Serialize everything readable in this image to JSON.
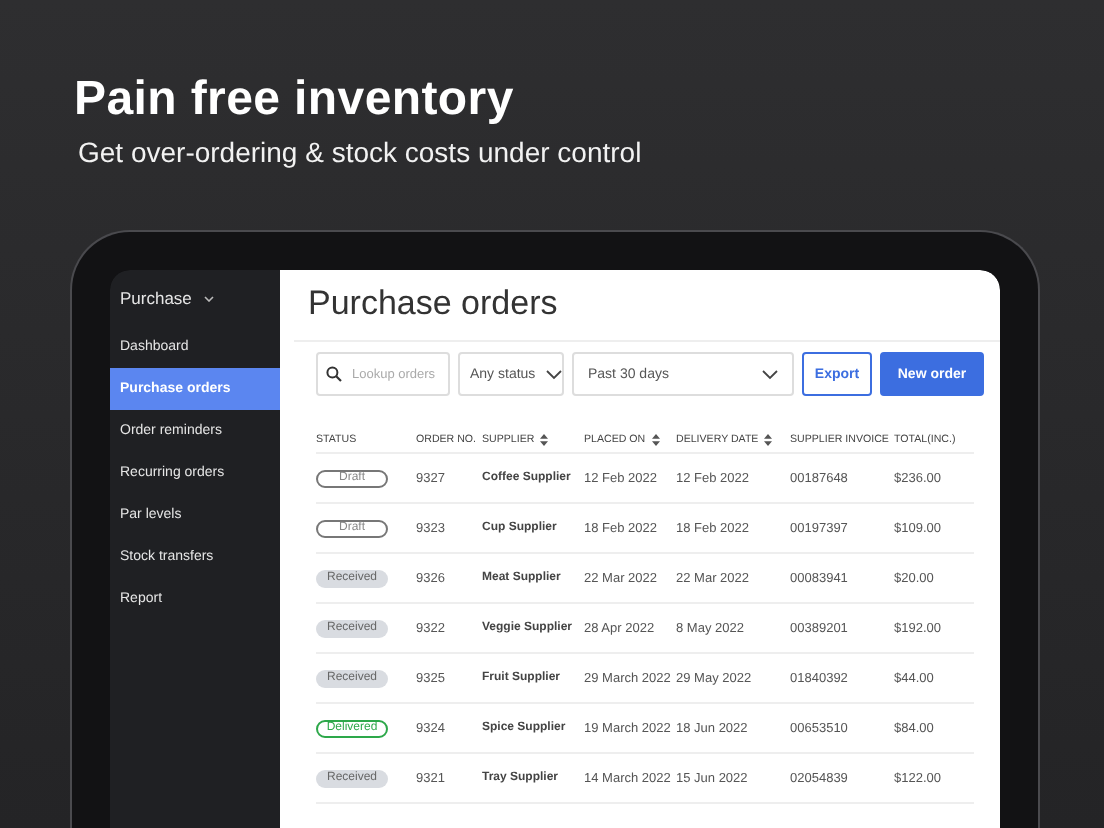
{
  "headline": {
    "title": "Pain free inventory",
    "subtitle": "Get over-ordering & stock costs under control"
  },
  "sidebar": {
    "section": "Purchase",
    "items": [
      {
        "label": "Dashboard",
        "selected": false
      },
      {
        "label": "Purchase orders",
        "selected": true
      },
      {
        "label": "Order reminders",
        "selected": false
      },
      {
        "label": "Recurring orders",
        "selected": false
      },
      {
        "label": "Par levels",
        "selected": false
      },
      {
        "label": "Stock transfers",
        "selected": false
      },
      {
        "label": "Report",
        "selected": false
      }
    ]
  },
  "page": {
    "title": "Purchase orders",
    "search": {
      "placeholder": "Lookup orders"
    },
    "status_filter": "Any status",
    "date_filter": "Past 30 days",
    "buttons": [
      {
        "label": "Export",
        "kind": "secondary"
      },
      {
        "label": "New order",
        "kind": "primary"
      }
    ]
  },
  "table": {
    "columns": [
      {
        "label": "STATUS",
        "sortable": false
      },
      {
        "label": "ORDER NO.",
        "sortable": false
      },
      {
        "label": "SUPPLIER",
        "sortable": true
      },
      {
        "label": "PLACED ON",
        "sortable": true
      },
      {
        "label": "DELIVERY DATE",
        "sortable": true
      },
      {
        "label": "SUPPLIER INVOICE",
        "sortable": false
      },
      {
        "label": "TOTAL(INC.)",
        "sortable": false
      }
    ],
    "rows": [
      {
        "status": {
          "label": "Draft",
          "kind": "draft"
        },
        "order_no": "9327",
        "supplier": "Coffee Supplier",
        "placed_on": "12 Feb 2022",
        "delivery_date": "12 Feb 2022",
        "invoice": "00187648",
        "total": "$236.00"
      },
      {
        "status": {
          "label": "Draft",
          "kind": "draft"
        },
        "order_no": "9323",
        "supplier": "Cup Supplier",
        "placed_on": "18 Feb 2022",
        "delivery_date": "18 Feb 2022",
        "invoice": "00197397",
        "total": "$109.00"
      },
      {
        "status": {
          "label": "Received",
          "kind": "received"
        },
        "order_no": "9326",
        "supplier": "Meat Supplier",
        "placed_on": "22 Mar 2022",
        "delivery_date": "22 Mar 2022",
        "invoice": "00083941",
        "total": "$20.00"
      },
      {
        "status": {
          "label": "Received",
          "kind": "received"
        },
        "order_no": "9322",
        "supplier": "Veggie Supplier",
        "placed_on": "28 Apr 2022",
        "delivery_date": "8 May 2022",
        "invoice": "00389201",
        "total": "$192.00"
      },
      {
        "status": {
          "label": "Received",
          "kind": "received"
        },
        "order_no": "9325",
        "supplier": "Fruit Supplier",
        "placed_on": "29 March 2022",
        "delivery_date": "29 May 2022",
        "invoice": "01840392",
        "total": "$44.00"
      },
      {
        "status": {
          "label": "Delivered",
          "kind": "delivered"
        },
        "order_no": "9324",
        "supplier": "Spice Supplier",
        "placed_on": "19 March 2022",
        "delivery_date": "18 Jun 2022",
        "invoice": "00653510",
        "total": "$84.00"
      },
      {
        "status": {
          "label": "Received",
          "kind": "received"
        },
        "order_no": "9321",
        "supplier": "Tray Supplier",
        "placed_on": "14 March 2022",
        "delivery_date": "15 Jun 2022",
        "invoice": "02054839",
        "total": "$122.00"
      }
    ]
  }
}
